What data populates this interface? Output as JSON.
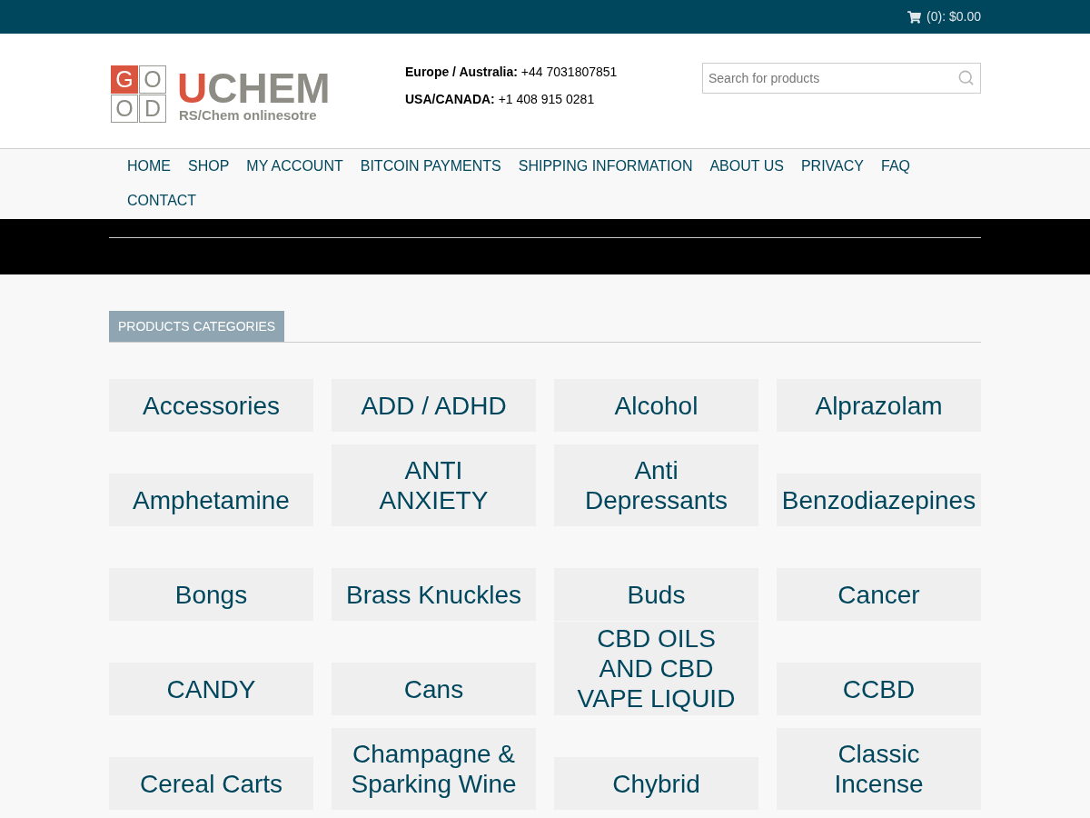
{
  "top_bar": {
    "cart": {
      "summary": "(0): $0.00"
    }
  },
  "header": {
    "logo": {
      "letters": [
        {
          "char": "G",
          "filled": true
        },
        {
          "char": "O",
          "filled": false
        },
        {
          "char": "O",
          "filled": false
        },
        {
          "char": "D",
          "filled": false
        }
      ],
      "wordmark": {
        "initial": "U",
        "rest": "CHEM"
      },
      "tagline": "RS/Chem onlinesotre"
    },
    "contacts": [
      "**Europe / Australia:** +44 7031807851",
      "**USA/CANADA:** +1 408 915 0281"
    ],
    "search": {
      "placeholder": "Search for products"
    }
  },
  "nav": {
    "items": [
      "HOME",
      "SHOP",
      "MY ACCOUNT",
      "BITCOIN PAYMENTS",
      "SHIPPING INFORMATION",
      "ABOUT US",
      "PRIVACY",
      "FAQ",
      "CONTACT"
    ]
  },
  "section": {
    "title": "PRODUCTS CATEGORIES",
    "categories": [
      "Accessories",
      "ADD / ADHD",
      "Alcohol",
      "Alprazolam",
      "Amphetamine",
      "ANTI\nANXIETY",
      "Anti\nDepressants",
      "Benzodiazepines",
      "Bongs",
      "Brass Knuckles",
      "Buds",
      "Cancer",
      "CANDY",
      "Cans",
      "CBD OILS\nAND CBD\nVAPE LIQUID",
      "CCBD",
      "Cereal Carts",
      "Champagne &\nSparking Wine",
      "Chybrid",
      "Classic\nIncense"
    ]
  }
}
